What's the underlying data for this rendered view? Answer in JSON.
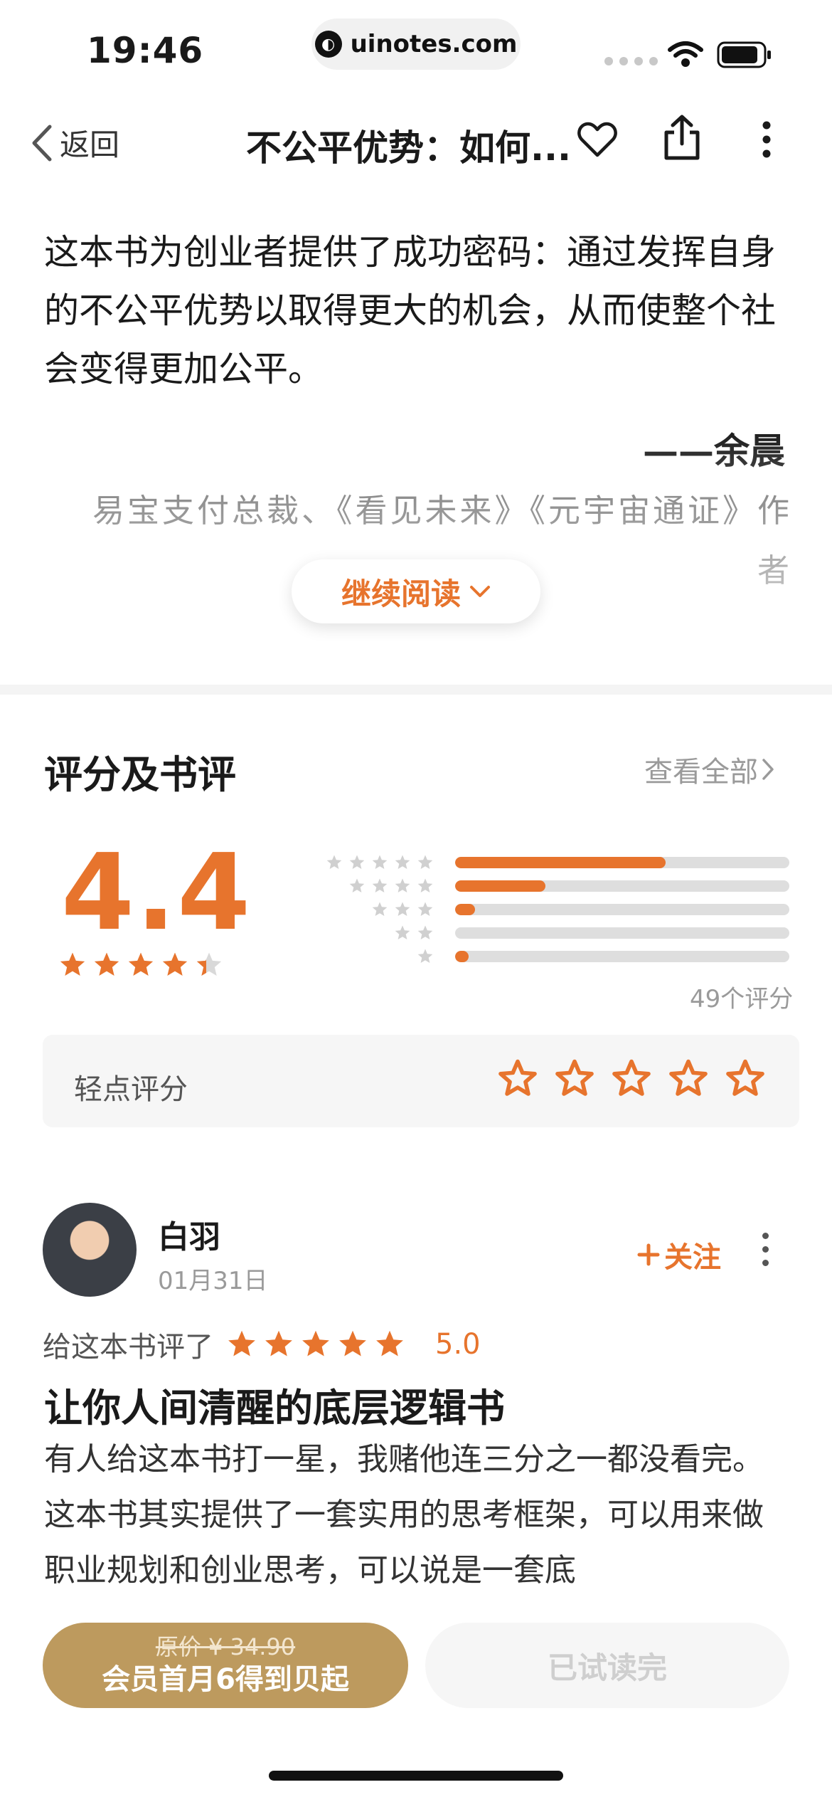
{
  "status_bar": {
    "time": "19:46",
    "url": "uinotes.com"
  },
  "nav": {
    "back_label": "返回",
    "title": "不公平优势：如何..."
  },
  "intro": {
    "quote": "这本书为创业者提供了成功密码：通过发挥自身的不公平优势以取得更大的机会，从而使整个社会变得更加公平。",
    "author": "——余晨",
    "author_desc": "易宝支付总裁、《看见未来》《元宇宙通证》作者",
    "continue_label": "继续阅读"
  },
  "ratings": {
    "section_title": "评分及书评",
    "see_all": "查看全部",
    "score": "4.4",
    "score_stars": 4.4,
    "count": "49个评分",
    "distribution": [
      {
        "stars": 5,
        "fraction": 0.63
      },
      {
        "stars": 4,
        "fraction": 0.27
      },
      {
        "stars": 3,
        "fraction": 0.06
      },
      {
        "stars": 2,
        "fraction": 0.0
      },
      {
        "stars": 1,
        "fraction": 0.04
      }
    ],
    "tap_rate_label": "轻点评分"
  },
  "review": {
    "username": "白羽",
    "date": "01月31日",
    "follow_label": "关注",
    "rate_prefix": "给这本书评了",
    "rating_value": "5.0",
    "title": "让你人间清醒的底层逻辑书",
    "body": "有人给这本书打一星，我赌他连三分之一都没看完。这本书其实提供了一套实用的思考框架，可以用来做职业规划和创业思考，可以说是一套底"
  },
  "bottom_bar": {
    "original_price": "原价 ¥ 34.90",
    "member_label": "会员首月6得到贝起",
    "trial_label": "已试读完"
  },
  "colors": {
    "accent": "#e7742d",
    "gold": "#bd9a5e"
  }
}
